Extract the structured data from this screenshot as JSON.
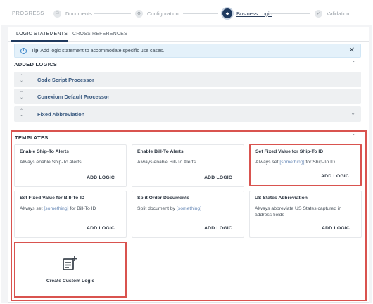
{
  "progress": {
    "label": "PROGRESS",
    "steps": [
      {
        "label": "Documents",
        "icon": "document-icon"
      },
      {
        "label": "Configuration",
        "icon": "gear-icon"
      },
      {
        "label": "Business Logic",
        "icon": "logic-icon"
      },
      {
        "label": "Validation",
        "icon": "check-icon"
      }
    ]
  },
  "tabs": [
    {
      "label": "LOGIC STATEMENTS"
    },
    {
      "label": "CROSS REFERENCES"
    }
  ],
  "tip": {
    "title": "Tip",
    "text": "Add logic statement to accommodate specific use cases."
  },
  "added_logics": {
    "title": "ADDED LOGICS",
    "items": [
      {
        "name": "Code Script Processor"
      },
      {
        "name": "Conexiom Default Processor"
      },
      {
        "name": "Fixed Abbreviation"
      }
    ]
  },
  "templates": {
    "title": "TEMPLATES",
    "add_label": "ADD LOGIC",
    "cards": [
      {
        "title": "Enable Ship-To Alerts",
        "desc": "Always enable Ship-To Alerts."
      },
      {
        "title": "Enable Bill-To Alerts",
        "desc": "Always enable Bill-To Alerts."
      },
      {
        "title": "Set Fixed Value for Ship-To ID",
        "desc_pre": "Always set ",
        "placeholder": "[something]",
        "desc_post": " for Ship-To ID"
      },
      {
        "title": "Set Fixed Value for Bill-To ID",
        "desc_pre": "Always set ",
        "placeholder": "[something]",
        "desc_post": " for Bill-To ID"
      },
      {
        "title": "Split Order Documents",
        "desc_pre": "Split document by ",
        "placeholder": "[something]",
        "desc_post": ""
      },
      {
        "title": "US States Abbreviation",
        "desc": "Always abbreviate US States captured in address fields"
      }
    ],
    "custom_label": "Create Custom Logic"
  },
  "colors": {
    "accent": "#1f3a5f",
    "highlight": "#d9534f",
    "tip_bg": "#e4f1fa",
    "link": "#3a5a80"
  }
}
